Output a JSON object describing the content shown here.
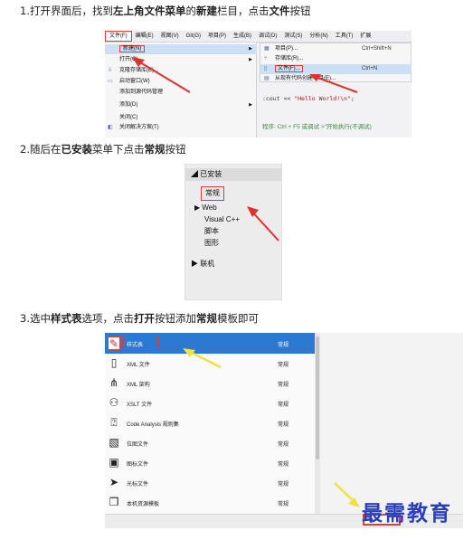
{
  "steps": {
    "step1": {
      "parts": [
        "1.打开界面后，找到",
        "左上角文件菜单",
        "的",
        "新建",
        "栏目，点击",
        "文件",
        "按钮"
      ]
    },
    "step2": {
      "parts": [
        "2.随后在",
        "已安装",
        "菜单下点击",
        "常规",
        "按钮"
      ]
    },
    "step3": {
      "parts": [
        "3.选中",
        "样式表",
        "选项，点击",
        "打开",
        "按钮添加",
        "常规",
        "模板即可"
      ]
    }
  },
  "screenshot1": {
    "menubar": [
      "文件(F)",
      "编辑(E)",
      "视图(V)",
      "Git(G)",
      "项目(P)",
      "生成(B)",
      "调试(D)",
      "测试(S)",
      "分析(N)",
      "工具(T)",
      "扩展"
    ],
    "file_menu": [
      {
        "label": "新建(N)",
        "icon": "",
        "submenu": true
      },
      {
        "label": "打开(O)",
        "icon": "",
        "submenu": true
      },
      {
        "label": "克隆存储库(E)...",
        "icon": "clone-icon",
        "submenu": false
      },
      {
        "label": "启动窗口(W)",
        "icon": "window-icon",
        "submenu": false
      },
      {
        "label": "添加到源代码管理",
        "icon": "",
        "submenu": false
      },
      {
        "label": "添加(D)",
        "icon": "",
        "submenu": true
      },
      {
        "label": "关闭(C)",
        "icon": "",
        "submenu": false
      },
      {
        "label": "关闭解决方案(T)",
        "icon": "solution-icon",
        "submenu": false
      }
    ],
    "new_submenu": [
      {
        "label": "项目(P)...",
        "shortcut": "Ctrl+Shift+N",
        "icon": "project-icon"
      },
      {
        "label": "存储库(R)...",
        "shortcut": "",
        "icon": "repo-icon"
      },
      {
        "label": "文件(F)...",
        "shortcut": "Ctrl+N",
        "icon": "file-icon"
      },
      {
        "label": "从现有代码创建项目(E)...",
        "shortcut": "",
        "icon": "code-icon"
      }
    ],
    "code_line_prefix": ":cout << ",
    "code_line_string": "\"Hello World!\\n\";",
    "comment_line": "程序: Ctrl + F5 或调试 >\"开始执行(不调试)"
  },
  "screenshot2": {
    "header": "◢ 已安装",
    "selected": "常规",
    "items": [
      "▶  Web",
      "Visual C++",
      "脚本",
      "图形"
    ],
    "footer": "▶  联机"
  },
  "screenshot3": {
    "items": [
      {
        "name": "样式表",
        "category": "常规",
        "icon": "stylesheet-icon",
        "glyph": "✎"
      },
      {
        "name": "XML 文件",
        "category": "常规",
        "icon": "xml-file-icon",
        "glyph": "▯"
      },
      {
        "name": "XML 架构",
        "category": "常规",
        "icon": "xml-schema-icon",
        "glyph": "⋔"
      },
      {
        "name": "XSLT 文件",
        "category": "常规",
        "icon": "xslt-file-icon",
        "glyph": "⚇"
      },
      {
        "name": "Code Analysis 规则集",
        "category": "常规",
        "icon": "ruleset-icon",
        "glyph": "⍰"
      },
      {
        "name": "位图文件",
        "category": "常规",
        "icon": "bitmap-icon",
        "glyph": "▧"
      },
      {
        "name": "图标文件",
        "category": "常规",
        "icon": "icon-file-icon",
        "glyph": "▣"
      },
      {
        "name": "光标文件",
        "category": "常规",
        "icon": "cursor-file-icon",
        "glyph": "➤"
      },
      {
        "name": "本机资源模板",
        "category": "常规",
        "icon": "resource-template-icon",
        "glyph": "❐"
      }
    ]
  },
  "watermark": "最需教育",
  "colors": {
    "highlight_box": "#d84040",
    "selected_row": "#2b79d0",
    "watermark": "#2a3dbb",
    "arrow": "#e03030",
    "yellow_arrow": "#f0e040"
  }
}
